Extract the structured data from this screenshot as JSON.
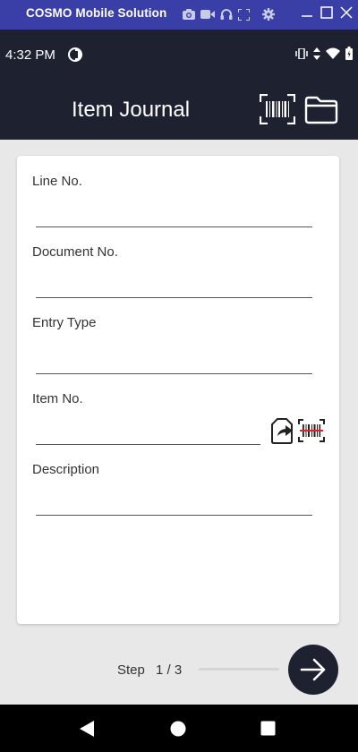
{
  "emulator": {
    "title": "COSMO Mobile Solution",
    "icons": [
      "camera-icon",
      "video-icon",
      "headset-icon",
      "fullscreen-icon",
      "settings-icon"
    ],
    "window_controls": [
      "minimize-icon",
      "maximize-icon",
      "close-icon"
    ]
  },
  "status_bar": {
    "time": "4:32 PM",
    "icons": [
      "vibrate-icon",
      "data-arrows-icon",
      "wifi-icon",
      "battery-icon"
    ]
  },
  "app_bar": {
    "title": "Item Journal",
    "actions": [
      "barcode-scan-icon",
      "folder-icon"
    ]
  },
  "form": {
    "fields": [
      {
        "label": "Line No.",
        "value": ""
      },
      {
        "label": "Document No.",
        "value": ""
      },
      {
        "label": "Entry Type",
        "value": ""
      },
      {
        "label": "Item No.",
        "value": ""
      },
      {
        "label": "Description",
        "value": ""
      }
    ],
    "item_actions": [
      "lookup-share-icon",
      "barcode-reader-icon"
    ]
  },
  "step": {
    "label": "Step",
    "current_of_total": "1 / 3",
    "progress": 0
  },
  "colors": {
    "emulator_bar": "#3a3fa8",
    "app_bar": "#1e2130",
    "background": "#e8e8e8",
    "scanner_accent": "#e0202a"
  }
}
